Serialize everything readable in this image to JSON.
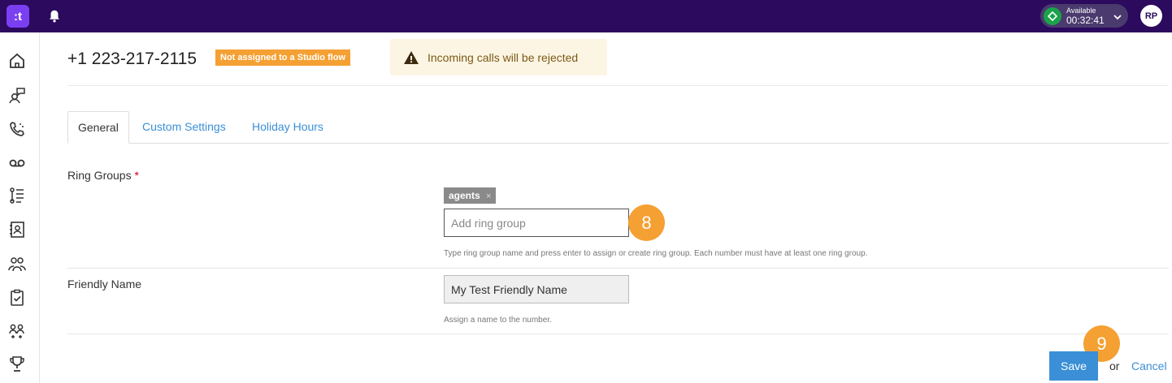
{
  "topbar": {
    "logo_text": ":t",
    "status_label": "Available",
    "status_timer": "00:32:41",
    "avatar_initials": "RP"
  },
  "sidebar": {
    "icons": [
      "home-icon",
      "contact-chat-icon",
      "phone-calls-icon",
      "voicemail-icon",
      "list-icon",
      "contacts-book-icon",
      "team-icon",
      "tasks-icon",
      "users-icon",
      "trophy-icon"
    ]
  },
  "header": {
    "phone_number": "+1 223-217-2115",
    "flow_badge": "Not assigned to a Studio flow",
    "alert_text": "Incoming calls will be rejected"
  },
  "tabs": [
    {
      "label": "General",
      "active": true
    },
    {
      "label": "Custom Settings",
      "active": false
    },
    {
      "label": "Holiday Hours",
      "active": false
    }
  ],
  "form": {
    "ring_groups_label": "Ring Groups",
    "required_marker": "*",
    "ring_group_chip": "agents",
    "chip_remove": "×",
    "ring_group_placeholder": "Add ring group",
    "ring_group_help": "Type ring group name and press enter to assign or create ring group. Each number must have at least one ring group.",
    "friendly_name_label": "Friendly Name",
    "friendly_name_value": "My Test Friendly Name",
    "friendly_name_help": "Assign a name to the number."
  },
  "markers": {
    "step8": "8",
    "step9": "9"
  },
  "actions": {
    "save_label": "Save",
    "or_text": "or",
    "cancel_label": "Cancel"
  },
  "colors": {
    "topbar": "#2c0a5e",
    "accent_blue": "#3a8fd6",
    "badge_orange": "#f5a033",
    "status_green": "#1aa34a"
  }
}
